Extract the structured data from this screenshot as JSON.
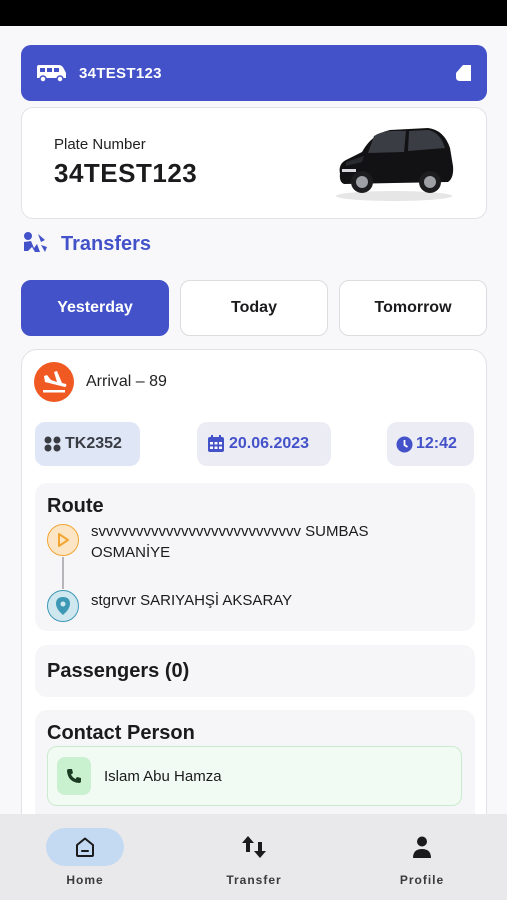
{
  "vehicle_bar": {
    "plate": "34TEST123"
  },
  "plate_card": {
    "label": "Plate Number",
    "value": "34TEST123"
  },
  "section": {
    "title": "Transfers"
  },
  "day_tabs": [
    {
      "label": "Yesterday",
      "active": true
    },
    {
      "label": "Today",
      "active": false
    },
    {
      "label": "Tomorrow",
      "active": false
    }
  ],
  "transfer": {
    "type_label": "Arrival – 89",
    "flight": "TK2352",
    "date": "20.06.2023",
    "time": "12:42",
    "route": {
      "title": "Route",
      "from": "svvvvvvvvvvvvvvvvvvvvvvvvvvv SUMBAS OSMANİYE",
      "to": "stgrvvr SARIYAHŞİ AKSARAY"
    },
    "passengers_title": "Passengers (0)",
    "contact": {
      "title": "Contact Person",
      "name": "Islam Abu Hamza"
    }
  },
  "nav": {
    "items": [
      {
        "label": "Home",
        "icon": "home-icon",
        "active": true
      },
      {
        "label": "Transfer",
        "icon": "transfer-icon",
        "active": false
      },
      {
        "label": "Profile",
        "icon": "person-icon",
        "active": false
      }
    ]
  },
  "colors": {
    "primary": "#4352c9",
    "arrival": "#f05a22",
    "nav_active": "#c4daf2"
  }
}
